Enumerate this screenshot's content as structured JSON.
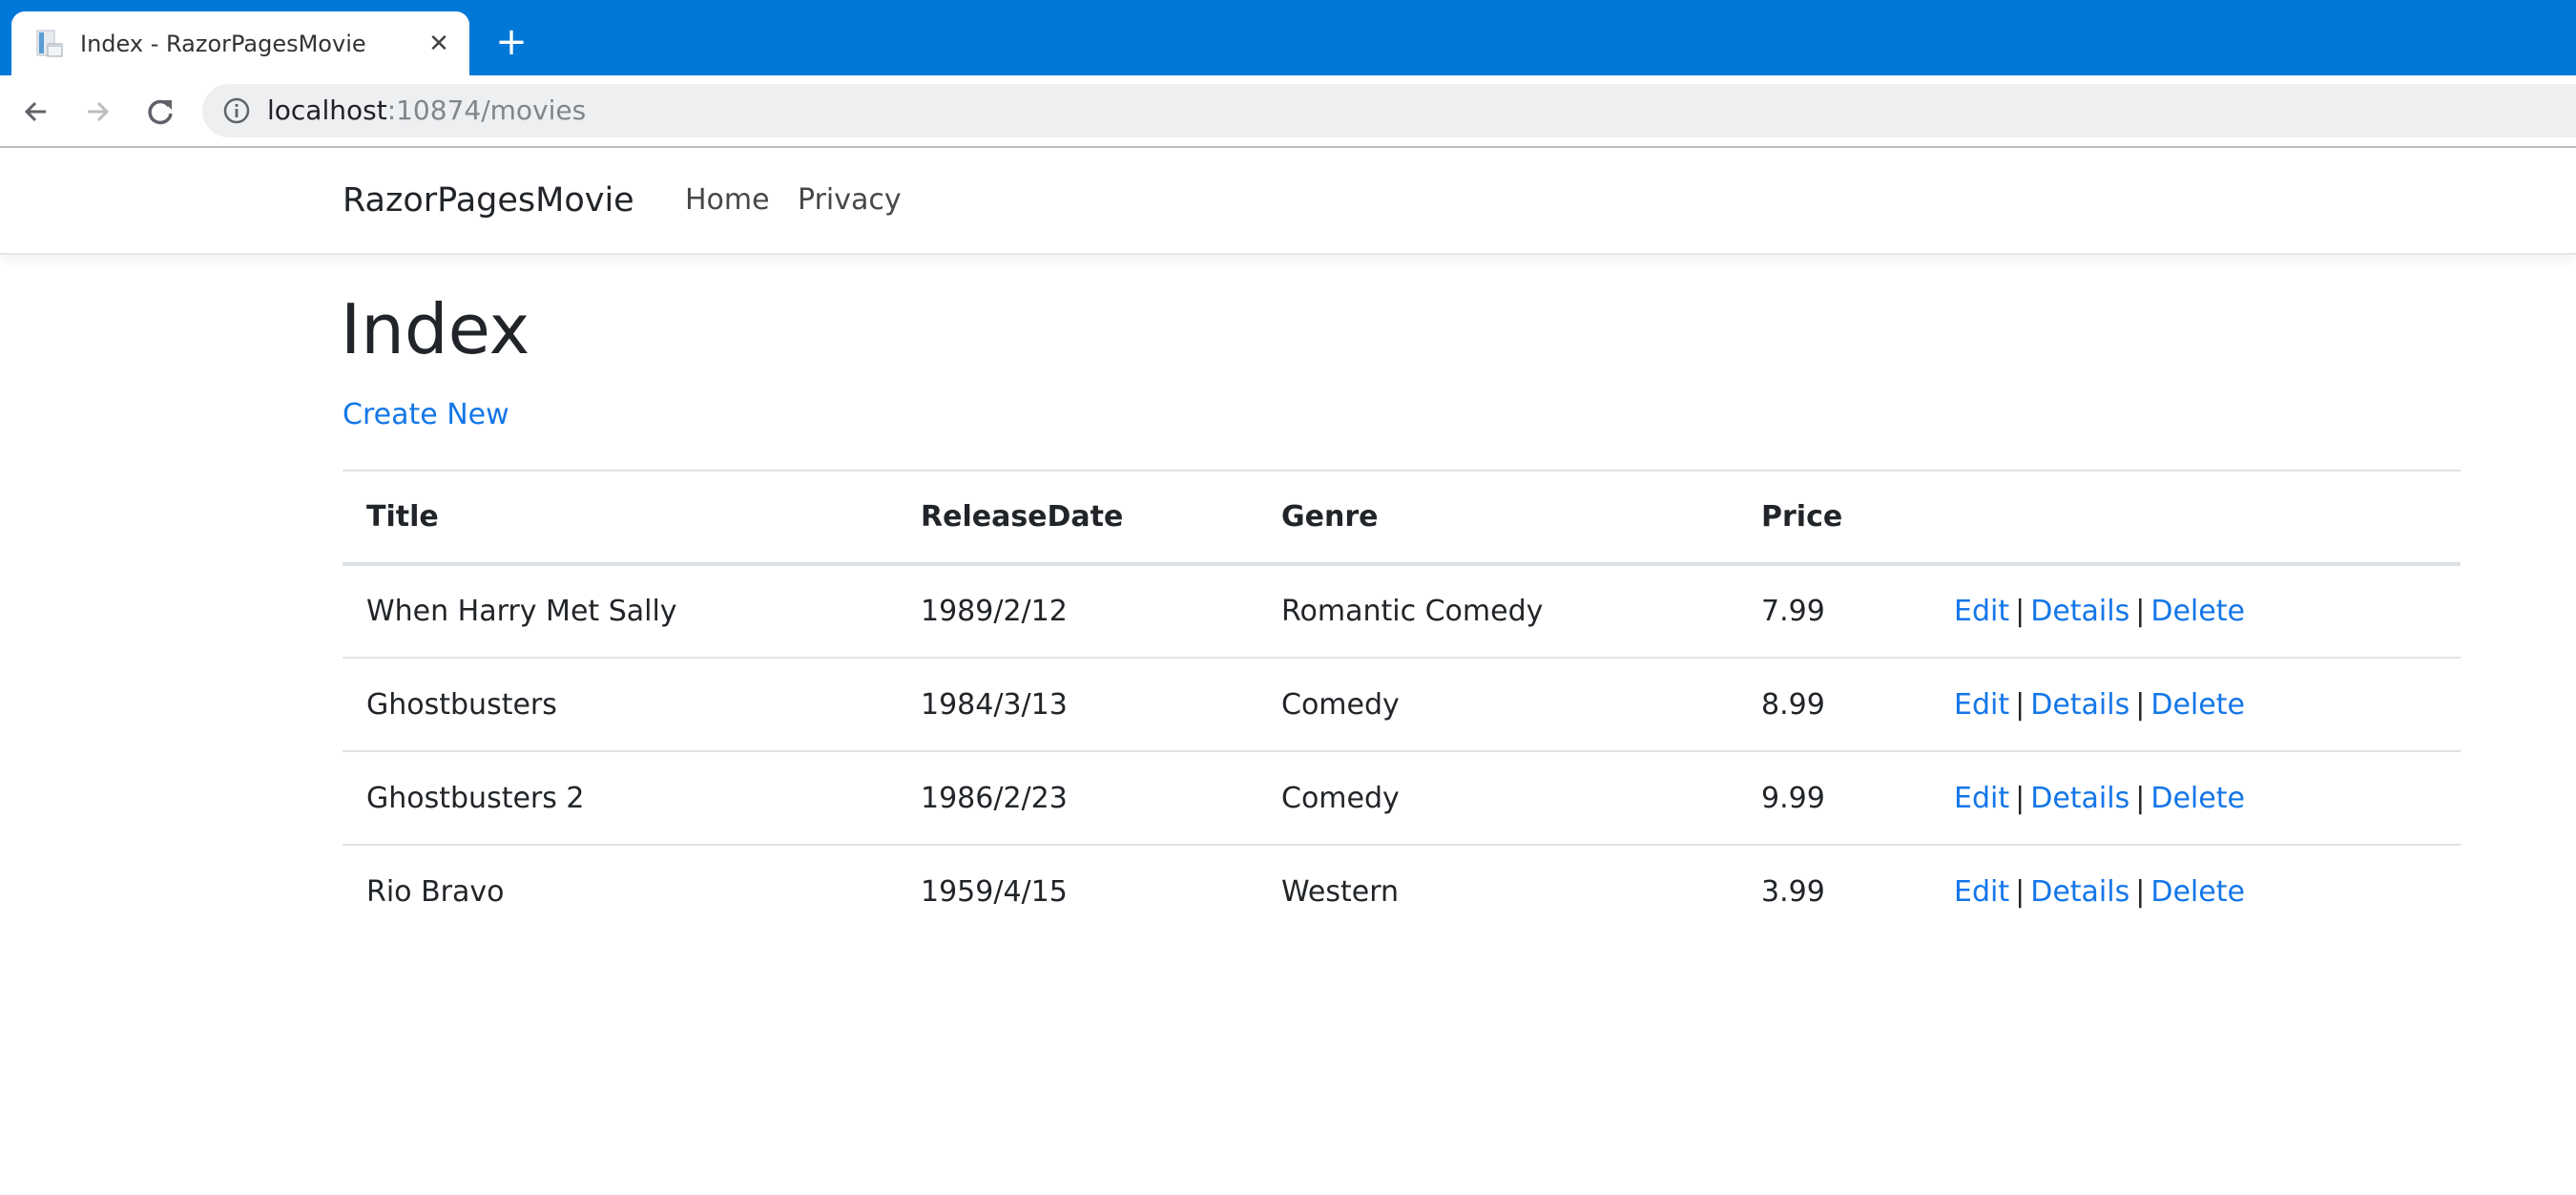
{
  "browser": {
    "tab": {
      "title": "Index - RazorPagesMovie",
      "favicon": "page-icon",
      "close_icon": "close-icon"
    },
    "new_tab_icon": "plus-icon",
    "nav": {
      "back_icon": "arrow-left-icon",
      "forward_icon": "arrow-right-icon",
      "reload_icon": "reload-icon"
    },
    "address_bar": {
      "info_icon": "info-icon",
      "host": "localhost",
      "rest": ":10874/movies"
    },
    "colors": {
      "tabbar": "#0078d7",
      "omnibox": "#eeeff1"
    }
  },
  "navbar": {
    "brand": "RazorPagesMovie",
    "links": [
      {
        "label": "Home"
      },
      {
        "label": "Privacy"
      }
    ]
  },
  "main": {
    "title": "Index",
    "create_new": "Create New",
    "link_color": "#1376e8",
    "table": {
      "columns": [
        "Title",
        "ReleaseDate",
        "Genre",
        "Price",
        ""
      ],
      "rows": [
        {
          "title": "When Harry Met Sally",
          "release_date": "1989/2/12",
          "genre": "Romantic Comedy",
          "price": "7.99"
        },
        {
          "title": "Ghostbusters",
          "release_date": "1984/3/13",
          "genre": "Comedy",
          "price": "8.99"
        },
        {
          "title": "Ghostbusters 2",
          "release_date": "1986/2/23",
          "genre": "Comedy",
          "price": "9.99"
        },
        {
          "title": "Rio Bravo",
          "release_date": "1959/4/15",
          "genre": "Western",
          "price": "3.99"
        }
      ],
      "actions": {
        "edit": "Edit",
        "details": "Details",
        "delete": "Delete",
        "separator": "|"
      }
    }
  }
}
